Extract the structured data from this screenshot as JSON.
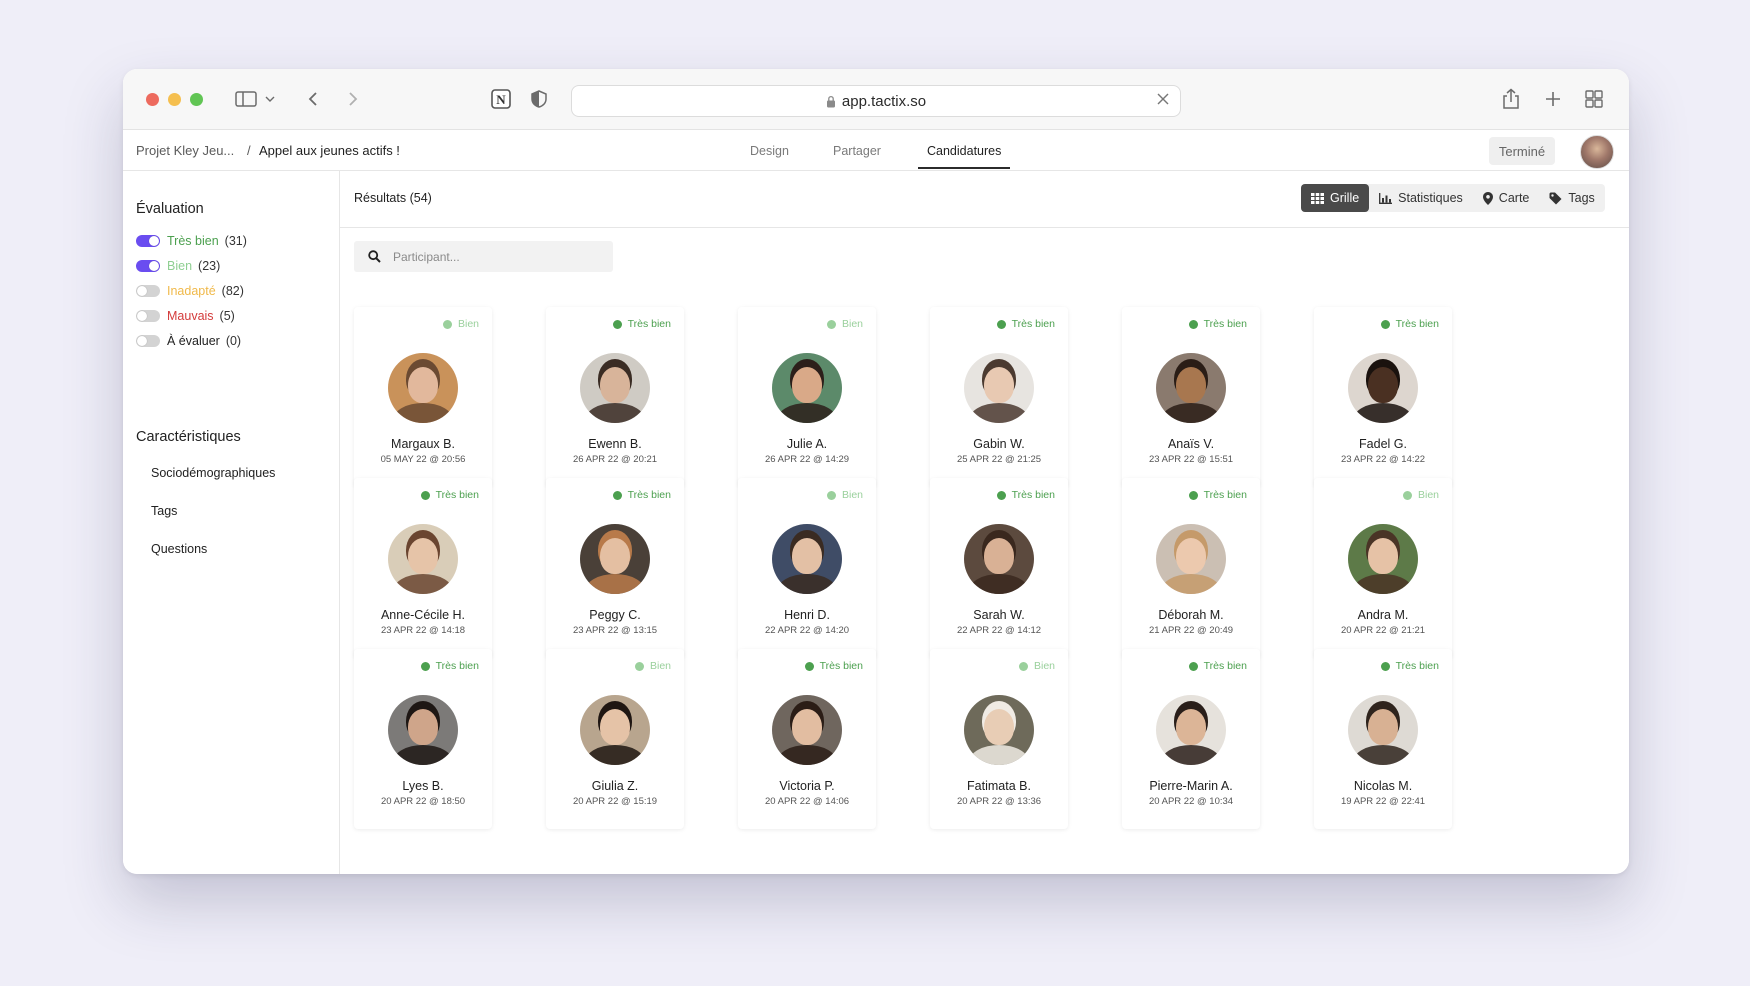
{
  "browser": {
    "url": "app.tactix.so"
  },
  "header": {
    "breadcrumb_project": "Projet Kley Jeu...",
    "breadcrumb_sep": "/",
    "breadcrumb_page": "Appel aux jeunes actifs !",
    "tabs": [
      {
        "label": "Design",
        "active": false
      },
      {
        "label": "Partager",
        "active": false
      },
      {
        "label": "Candidatures",
        "active": true
      }
    ],
    "status_button": "Terminé"
  },
  "sidebar": {
    "evaluation_title": "Évaluation",
    "evaluations": [
      {
        "label": "Très bien",
        "count": "(31)",
        "on": true,
        "color": "#4ca04f"
      },
      {
        "label": "Bien",
        "count": "(23)",
        "on": true,
        "color": "#8fcf92"
      },
      {
        "label": "Inadapté",
        "count": "(82)",
        "on": false,
        "color": "#f0b94a"
      },
      {
        "label": "Mauvais",
        "count": "(5)",
        "on": false,
        "color": "#d43b3b"
      },
      {
        "label": "À évaluer",
        "count": "(0)",
        "on": false,
        "color": "#222222"
      }
    ],
    "characteristics_title": "Caractéristiques",
    "characteristics": [
      "Sociodémographiques",
      "Tags",
      "Questions"
    ]
  },
  "main": {
    "results_label": "Résultats (54)",
    "views": [
      {
        "label": "Grille",
        "icon": "grid-icon",
        "active": true
      },
      {
        "label": "Statistiques",
        "icon": "bar-chart-icon",
        "active": false
      },
      {
        "label": "Carte",
        "icon": "map-pin-icon",
        "active": false
      },
      {
        "label": "Tags",
        "icon": "tag-icon",
        "active": false
      }
    ],
    "search_placeholder": "Participant..."
  },
  "candidates": [
    {
      "name": "Margaux B.",
      "date": "05 MAY 22 @ 20:56",
      "rating": "Bien",
      "skin": "#e2b89c",
      "hair": "#6b4a32",
      "bg": "#c9925a"
    },
    {
      "name": "Ewenn B.",
      "date": "26 APR 22 @ 20:21",
      "rating": "Très bien",
      "skin": "#d8b49a",
      "hair": "#3a2c24",
      "bg": "#cfcbc4"
    },
    {
      "name": "Julie A.",
      "date": "26 APR 22 @ 14:29",
      "rating": "Bien",
      "skin": "#d9a988",
      "hair": "#2c1f1a",
      "bg": "#5c8a6a"
    },
    {
      "name": "Gabin W.",
      "date": "25 APR 22 @ 21:25",
      "rating": "Très bien",
      "skin": "#e8c9b2",
      "hair": "#4b3a30",
      "bg": "#e7e4e0"
    },
    {
      "name": "Anaïs V.",
      "date": "23 APR 22 @ 15:51",
      "rating": "Très bien",
      "skin": "#a8774f",
      "hair": "#2a1d16",
      "bg": "#8a7a6e"
    },
    {
      "name": "Fadel G.",
      "date": "23 APR 22 @ 14:22",
      "rating": "Très bien",
      "skin": "#4a3022",
      "hair": "#1a120e",
      "bg": "#ddd6cf"
    },
    {
      "name": "Anne-Cécile H.",
      "date": "23 APR 22 @ 14:18",
      "rating": "Très bien",
      "skin": "#e6c4a8",
      "hair": "#6a4530",
      "bg": "#d9cdb8"
    },
    {
      "name": "Peggy C.",
      "date": "23 APR 22 @ 13:15",
      "rating": "Très bien",
      "skin": "#e4bfa2",
      "hair": "#b87a4a",
      "bg": "#4a4038"
    },
    {
      "name": "Henri D.",
      "date": "22 APR 22 @ 14:20",
      "rating": "Bien",
      "skin": "#e3c0a5",
      "hair": "#3a2b22",
      "bg": "#3f4c66"
    },
    {
      "name": "Sarah W.",
      "date": "22 APR 22 @ 14:12",
      "rating": "Très bien",
      "skin": "#d9b195",
      "hair": "#3a281e",
      "bg": "#5c4a3e"
    },
    {
      "name": "Déborah M.",
      "date": "21 APR 22 @ 20:49",
      "rating": "Très bien",
      "skin": "#ecc9ae",
      "hair": "#c59a6a",
      "bg": "#cbbfb3"
    },
    {
      "name": "Andra M.",
      "date": "20 APR 22 @ 21:21",
      "rating": "Bien",
      "skin": "#e6c2a6",
      "hair": "#4a3426",
      "bg": "#5d7a48"
    },
    {
      "name": "Lyes B.",
      "date": "20 APR 22 @ 18:50",
      "rating": "Très bien",
      "skin": "#cfa58a",
      "hair": "#1e1714",
      "bg": "#7c7a78"
    },
    {
      "name": "Giulia Z.",
      "date": "20 APR 22 @ 15:19",
      "rating": "Bien",
      "skin": "#e5c3a7",
      "hair": "#1f1612",
      "bg": "#b8a58e"
    },
    {
      "name": "Victoria P.",
      "date": "20 APR 22 @ 14:06",
      "rating": "Très bien",
      "skin": "#e2bda1",
      "hair": "#2b1d16",
      "bg": "#6f665e"
    },
    {
      "name": "Fatimata B.",
      "date": "20 APR 22 @ 13:36",
      "rating": "Bien",
      "skin": "#e8cdb5",
      "hair": "#f0ebe4",
      "bg": "#6e6a5a"
    },
    {
      "name": "Pierre-Marin A.",
      "date": "20 APR 22 @ 10:34",
      "rating": "Très bien",
      "skin": "#dcb597",
      "hair": "#2a1f1a",
      "bg": "#e6e2dc"
    },
    {
      "name": "Nicolas M.",
      "date": "19 APR 22 @ 22:41",
      "rating": "Très bien",
      "skin": "#d8b193",
      "hair": "#2f241d",
      "bg": "#dedad4"
    }
  ]
}
